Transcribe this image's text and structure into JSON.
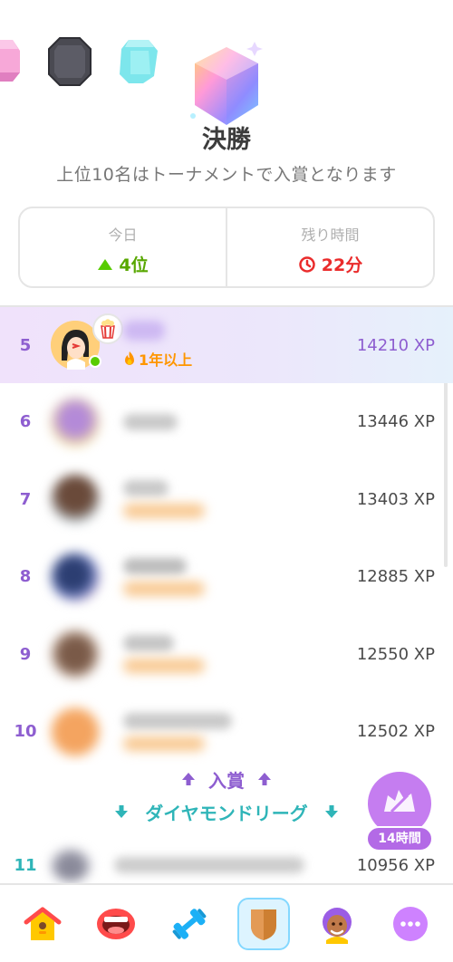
{
  "header": {
    "title": "決勝",
    "subtitle": "上位10名はトーナメントで入賞となります"
  },
  "stats": {
    "today_label": "今日",
    "today_value": "4位",
    "remaining_label": "残り時間",
    "remaining_value": "22分"
  },
  "leaderboard": {
    "me": {
      "rank": "5",
      "streak": "1年以上",
      "xp": "14210 XP"
    },
    "rows": [
      {
        "rank": "6",
        "xp": "13446 XP"
      },
      {
        "rank": "7",
        "xp": "13403 XP"
      },
      {
        "rank": "8",
        "xp": "12885 XP"
      },
      {
        "rank": "9",
        "xp": "12550 XP"
      },
      {
        "rank": "10",
        "xp": "12502 XP"
      }
    ],
    "row11": {
      "rank": "11",
      "xp": "10956 XP"
    }
  },
  "zones": {
    "promotion": "入賞",
    "league": "ダイヤモンドリーグ"
  },
  "timer_badge": "14時間",
  "colors": {
    "purple": "#8e5ed0",
    "green": "#58a700",
    "red": "#ea2b2b",
    "teal": "#2fb5b8",
    "orange": "#ff9600"
  },
  "nav": [
    "home-icon",
    "speaking-mouth-icon",
    "dumbbell-icon",
    "league-shield-icon",
    "profile-icon",
    "more-icon"
  ]
}
